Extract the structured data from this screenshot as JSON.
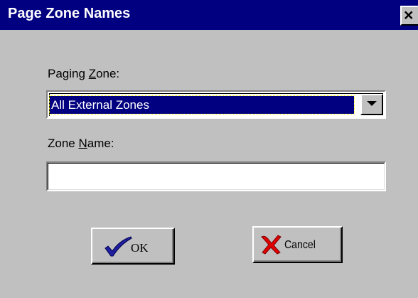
{
  "window": {
    "title": "Page Zone Names",
    "close_label": "×"
  },
  "paging_zone": {
    "label_pre": "Paging ",
    "label_accel": "Z",
    "label_post": "one:",
    "selected": "All External Zones"
  },
  "zone_name": {
    "label_pre": "Zone ",
    "label_accel": "N",
    "label_post": "ame:",
    "value": ""
  },
  "buttons": {
    "ok_label": "OK",
    "cancel_label": "Cancel"
  },
  "icons": {
    "ok": "checkmark-icon",
    "cancel": "x-mark-icon",
    "dropdown": "triangle-down-icon",
    "close": "close-icon"
  },
  "colors": {
    "titlebar": "#000080",
    "face": "#c0c0c0",
    "selection": "#000080",
    "check": "#1f1f9f",
    "cancel_x": "#e00000"
  }
}
